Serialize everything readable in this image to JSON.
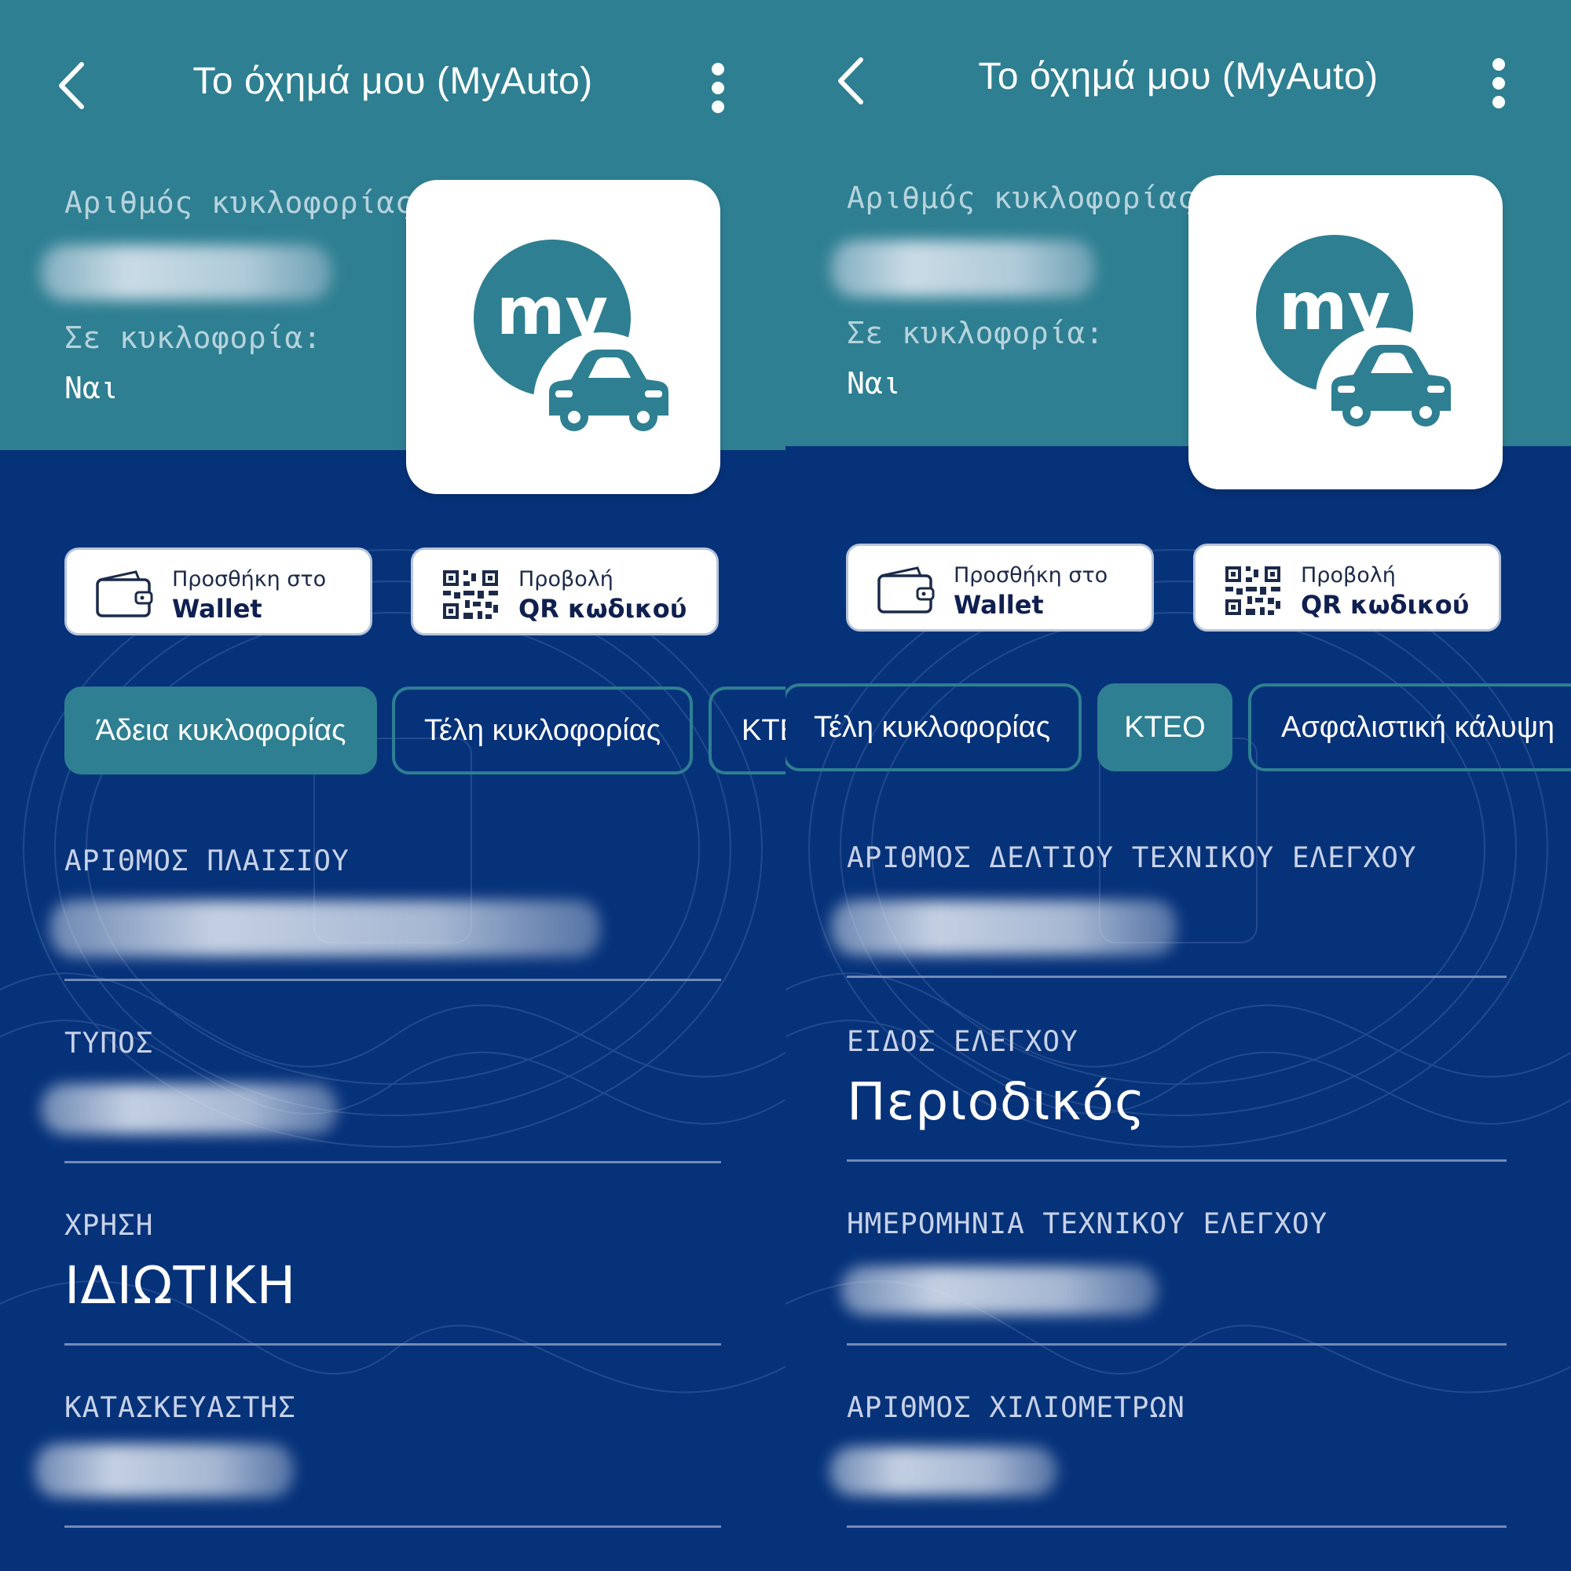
{
  "left": {
    "header_title": "Το όχημά μου (MyAuto)",
    "registration_label": "Αριθμός κυκλοφορίας:",
    "circulation_label": "Σε κυκλοφορία:",
    "circulation_value": "Ναι",
    "logo_text": "my",
    "wallet_button": {
      "small": "Προσθήκη στο",
      "big": "Wallet"
    },
    "qr_button": {
      "small": "Προβολή",
      "big": "QR κωδικού"
    },
    "tabs": [
      "Άδεια κυκλοφορίας",
      "Τέλη κυκλοφορίας",
      "ΚΤΕ"
    ],
    "active_tab": "Άδεια κυκλοφορίας",
    "fields": [
      {
        "label": "ΑΡΙΘΜΟΣ ΠΛΑΙΣΙΟΥ",
        "value": ""
      },
      {
        "label": "ΤΥΠΟΣ",
        "value": ""
      },
      {
        "label": "ΧΡΗΣΗ",
        "value": "ΙΔΙΩΤΙΚΗ"
      },
      {
        "label": "ΚΑΤΑΣΚΕΥΑΣΤΗΣ",
        "value": ""
      }
    ]
  },
  "right": {
    "header_title": "Το όχημά μου (MyAuto)",
    "registration_label": "Αριθμός κυκλοφορίας:",
    "circulation_label": "Σε κυκλοφορία:",
    "circulation_value": "Ναι",
    "logo_text": "my",
    "wallet_button": {
      "small": "Προσθήκη στο",
      "big": "Wallet"
    },
    "qr_button": {
      "small": "Προβολή",
      "big": "QR κωδικού"
    },
    "tabs": [
      "Τέλη κυκλοφορίας",
      "ΚΤΕΟ",
      "Ασφαλιστική κάλυψη"
    ],
    "active_tab": "ΚΤΕΟ",
    "fields": [
      {
        "label": "ΑΡΙΘΜΟΣ ΔΕΛΤΙΟΥ ΤΕΧΝΙΚΟΥ ΕΛΕΓΧΟΥ",
        "value": ""
      },
      {
        "label": "ΕΙΔΟΣ ΕΛΕΓΧΟΥ",
        "value": "Περιοδικός"
      },
      {
        "label": "ΗΜΕΡΟΜΗΝΙΑ ΤΕΧΝΙΚΟΥ ΕΛΕΓΧΟΥ",
        "value": ""
      },
      {
        "label": "ΑΡΙΘΜΟΣ ΧΙΛΙΟΜΕΤΡΩΝ",
        "value": ""
      }
    ]
  },
  "colors": {
    "teal": "#2e7f92",
    "navy": "#06327a",
    "white": "#ffffff"
  }
}
